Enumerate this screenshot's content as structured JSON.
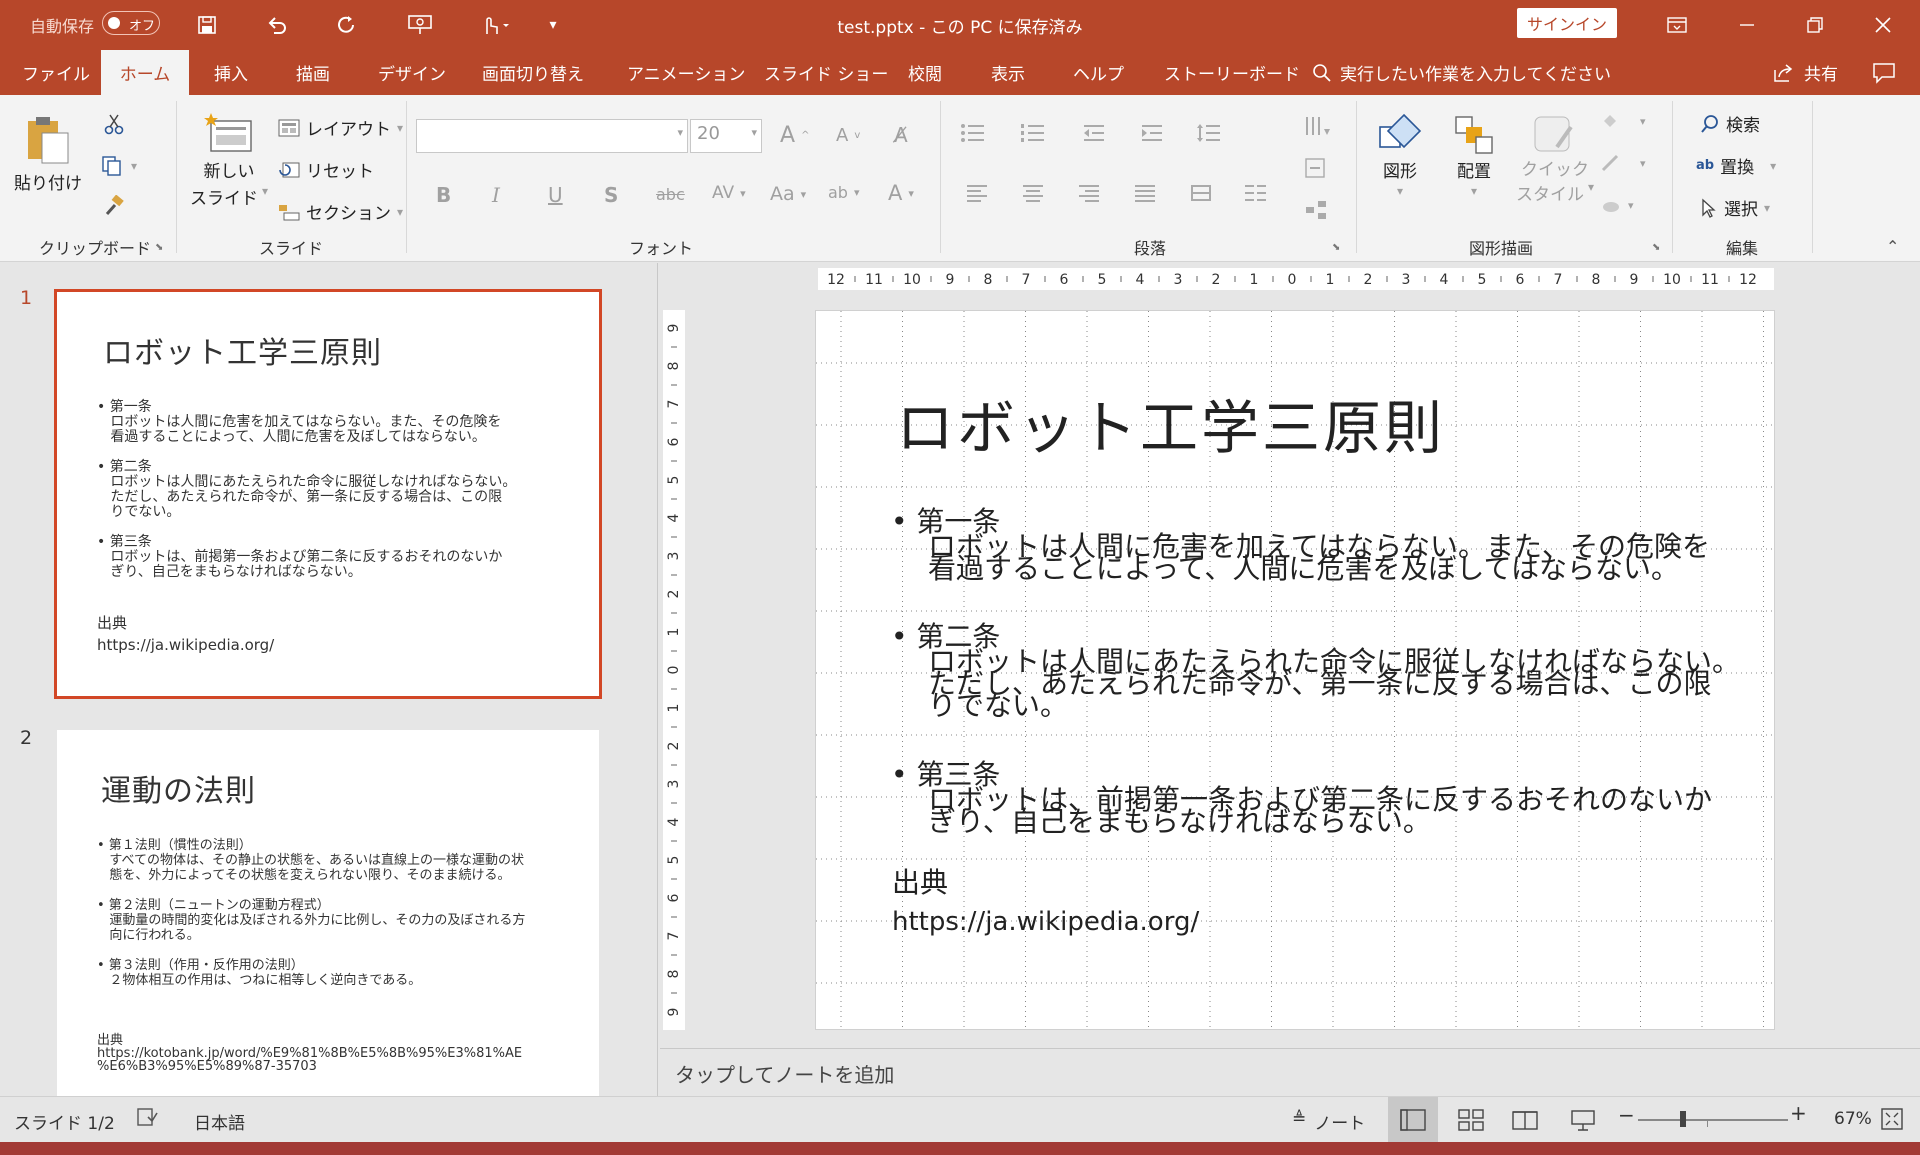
{
  "titlebar": {
    "autosave_label": "自動保存",
    "autosave_state": "オフ",
    "doc_title": "test.pptx - この PC に保存済み",
    "signin": "サインイン"
  },
  "tabs": [
    "ファイル",
    "ホーム",
    "挿入",
    "描画",
    "デザイン",
    "画面切り替え",
    "アニメーション",
    "スライド ショー",
    "校閲",
    "表示",
    "ヘルプ",
    "ストーリーボード"
  ],
  "tellme": "実行したい作業を入力してください",
  "share": "共有",
  "ribbon": {
    "paste": "貼り付け",
    "clipboard": "クリップボード",
    "new_slide_1": "新しい",
    "new_slide_2": "スライド",
    "layout": "レイアウト",
    "reset": "リセット",
    "section": "セクション",
    "slide_group": "スライド",
    "font_size": "20",
    "font_group": "フォント",
    "paragraph_group": "段落",
    "shapes": "図形",
    "arrange": "配置",
    "quick_style_1": "クイック",
    "quick_style_2": "スタイル",
    "drawing_group": "図形描画",
    "find": "検索",
    "replace": "置換",
    "select": "選択",
    "editing_group": "編集"
  },
  "thumbs": [
    {
      "num": "1",
      "title": "ロボット工学三原則",
      "body": "• 第一条\n   ロボットは人間に危害を加えてはならない。また、その危険を\n   看過することによって、人間に危害を及ぼしてはならない。\n\n• 第二条\n   ロボットは人間にあたえられた命令に服従しなければならない。\n   ただし、あたえられた命令が、第一条に反する場合は、この限\n   りでない。\n\n• 第三条\n   ロボットは、前掲第一条および第二条に反するおそれのないか\n   ぎり、自己をまもらなければならない。",
      "source": "出典\nhttps://ja.wikipedia.org/"
    },
    {
      "num": "2",
      "title": "運動の法則",
      "body": "• 第１法則（慣性の法則）\n   すべての物体は、その静止の状態を、あるいは直線上の一様な運動の状\n   態を、外力によってその状態を変えられない限り、そのまま続ける。\n\n• 第２法則（ニュートンの運動方程式）\n   運動量の時間的変化は及ぼされる外力に比例し、その力の及ぼされる方\n   向に行われる。\n\n• 第３法則（作用・反作用の法則）\n   ２物体相互の作用は、つねに相等しく逆向きである。",
      "source": "出典\nhttps://kotobank.jp/word/%E9%81%8B%E5%8B%95%E3%81%AE\n%E6%B3%95%E5%89%87-35703"
    }
  ],
  "slide": {
    "title": "ロボット工学三原則",
    "b1": "• 第一条",
    "b1t": "ロボットは人間に危害を加えてはならない。また、その危険を\n看過することによって、人間に危害を及ぼしてはならない。",
    "b2": "• 第二条",
    "b2t": "ロボットは人間にあたえられた命令に服従しなければならない。\nただし、あたえられた命令が、第一条に反する場合は、この限\nりでない。",
    "b3": "• 第三条",
    "b3t": "ロボットは、前掲第一条および第二条に反するおそれのないか\nぎり、自己をまもらなければならない。",
    "src_label": "出典",
    "src_url": "https://ja.wikipedia.org/"
  },
  "hruler_ticks": [
    "12",
    "11",
    "10",
    "9",
    "8",
    "7",
    "6",
    "5",
    "4",
    "3",
    "2",
    "1",
    "0",
    "1",
    "2",
    "3",
    "4",
    "5",
    "6",
    "7",
    "8",
    "9",
    "10",
    "11",
    "12"
  ],
  "vruler_ticks": [
    "9",
    "8",
    "7",
    "6",
    "5",
    "4",
    "3",
    "2",
    "1",
    "0",
    "1",
    "2",
    "3",
    "4",
    "5",
    "6",
    "7",
    "8",
    "9"
  ],
  "notes_placeholder": "タップしてノートを追加",
  "status": {
    "slide": "スライド 1/2",
    "lang": "日本語",
    "notes": "ノート",
    "zoom": "67%"
  },
  "colors": {
    "accent": "#b7472a"
  }
}
